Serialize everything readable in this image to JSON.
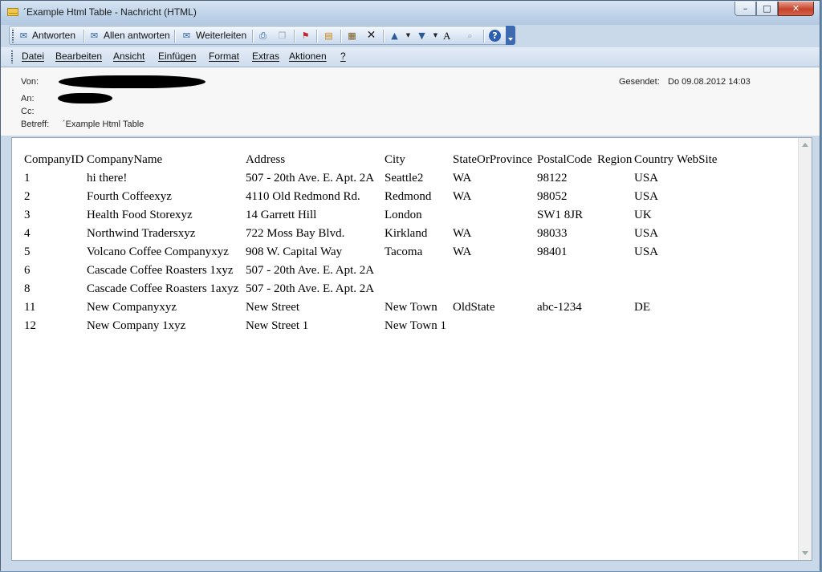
{
  "window": {
    "title": "´Example Html Table - Nachricht (HTML)",
    "controls": {
      "minimize": "–",
      "maximize": "□",
      "close": "✕"
    }
  },
  "toolbar": {
    "reply": "Antworten",
    "reply_all": "Allen antworten",
    "forward": "Weiterleiten",
    "font_size_glyph": "A"
  },
  "menu": [
    "Datei",
    "Bearbeiten",
    "Ansicht",
    "Einfügen",
    "Format",
    "Extras",
    "Aktionen",
    "?"
  ],
  "header": {
    "from_label": "Von:",
    "to_label": "An:",
    "cc_label": "Cc:",
    "subject_label": "Betreff:",
    "subject_value": "´Example Html Table",
    "sent_label": "Gesendet:",
    "sent_value": "Do 09.08.2012 14:03"
  },
  "table": {
    "headers": [
      "CompanyID",
      "CompanyName",
      "Address",
      "City",
      "StateOrProvince",
      "PostalCode",
      "Region",
      "Country",
      "WebSite"
    ],
    "rows": [
      [
        "1",
        "hi there!",
        "507 - 20th Ave. E. Apt. 2A",
        "Seattle2",
        "WA",
        "98122",
        "",
        "USA",
        ""
      ],
      [
        "2",
        "Fourth Coffeexyz",
        "4110 Old Redmond Rd.",
        "Redmond",
        "WA",
        "98052",
        "",
        "USA",
        ""
      ],
      [
        "3",
        "Health Food Storexyz",
        "14 Garrett Hill",
        "London",
        "",
        "SW1 8JR",
        "",
        "UK",
        ""
      ],
      [
        "4",
        "Northwind Tradersxyz",
        "722 Moss Bay Blvd.",
        "Kirkland",
        "WA",
        "98033",
        "",
        "USA",
        ""
      ],
      [
        "5",
        "Volcano Coffee Companyxyz",
        "908 W. Capital Way",
        "Tacoma",
        "WA",
        "98401",
        "",
        "USA",
        ""
      ],
      [
        "6",
        "Cascade Coffee Roasters 1xyz",
        "507 - 20th Ave. E. Apt. 2A",
        "",
        "",
        "",
        "",
        "",
        ""
      ],
      [
        "8",
        "Cascade Coffee Roasters 1axyz",
        "507 - 20th Ave. E. Apt. 2A",
        "",
        "",
        "",
        "",
        "",
        ""
      ],
      [
        "11",
        "New Companyxyz",
        "New Street",
        "New Town",
        "OldState",
        "abc-1234",
        "",
        "DE",
        ""
      ],
      [
        "12",
        "New Company 1xyz",
        "New Street 1",
        "New Town 1",
        "",
        "",
        "",
        "",
        ""
      ]
    ]
  }
}
